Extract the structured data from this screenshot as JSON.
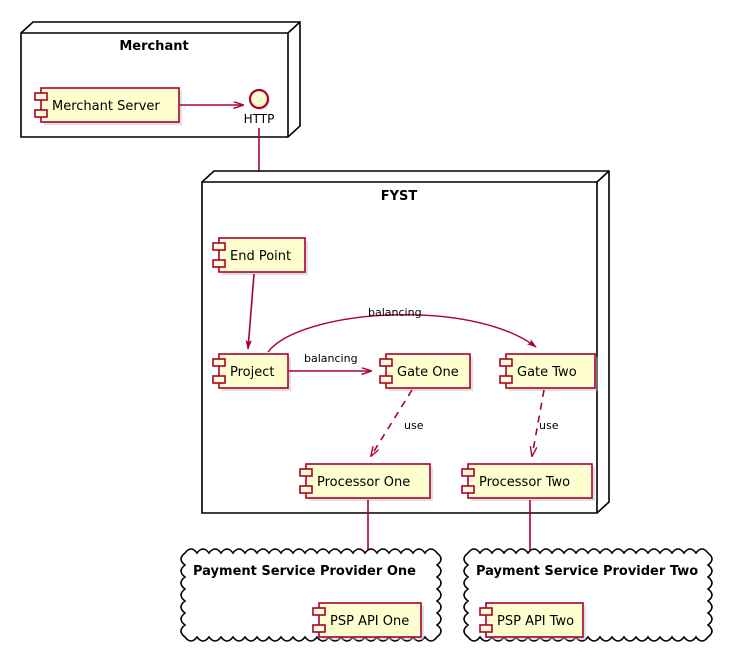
{
  "diagram": {
    "type": "uml-component-diagram",
    "background": "#FFFFFF",
    "colors": {
      "component_fill": "#FEFECE",
      "component_border": "#A80036",
      "node_border": "#000000",
      "node_fill": "#FFFFFF",
      "arrow": "#A80036",
      "shadow": "#BBBBBB",
      "text": "#000000"
    }
  },
  "nodes": {
    "merchant": {
      "title": "Merchant",
      "kind": "node"
    },
    "fyst": {
      "title": "FYST",
      "kind": "node"
    },
    "psp_one": {
      "title": "Payment Service Provider One",
      "kind": "cloud"
    },
    "psp_two": {
      "title": "Payment Service Provider Two",
      "kind": "cloud"
    }
  },
  "components": {
    "merchant_server": "Merchant Server",
    "end_point": "End Point",
    "project": "Project",
    "gate_one": "Gate One",
    "gate_two": "Gate Two",
    "processor_one": "Processor One",
    "processor_two": "Processor Two",
    "psp_api_one": "PSP API One",
    "psp_api_two": "PSP API Two"
  },
  "interfaces": {
    "http": "HTTP"
  },
  "edges": [
    {
      "id": "merchant-server-to-http",
      "from": "Merchant Server",
      "to": "HTTP",
      "label": "",
      "style": "solid"
    },
    {
      "id": "http-to-end-point",
      "from": "HTTP",
      "to": "End Point",
      "label": "",
      "style": "solid"
    },
    {
      "id": "end-point-to-project",
      "from": "End Point",
      "to": "Project",
      "label": "",
      "style": "solid"
    },
    {
      "id": "project-to-gate-one",
      "from": "Project",
      "to": "Gate One",
      "label": "balancing",
      "style": "solid"
    },
    {
      "id": "project-to-gate-two",
      "from": "Project",
      "to": "Gate Two",
      "label": "balancing",
      "style": "solid"
    },
    {
      "id": "gate-one-to-processor-one",
      "from": "Gate One",
      "to": "Processor One",
      "label": "use",
      "style": "dashed"
    },
    {
      "id": "gate-two-to-processor-two",
      "from": "Gate Two",
      "to": "Processor Two",
      "label": "use",
      "style": "dashed"
    },
    {
      "id": "processor-one-to-psp-api-one",
      "from": "Processor One",
      "to": "PSP API One",
      "label": "",
      "style": "solid"
    },
    {
      "id": "processor-two-to-psp-api-two",
      "from": "Processor Two",
      "to": "PSP API Two",
      "label": "",
      "style": "solid"
    }
  ]
}
